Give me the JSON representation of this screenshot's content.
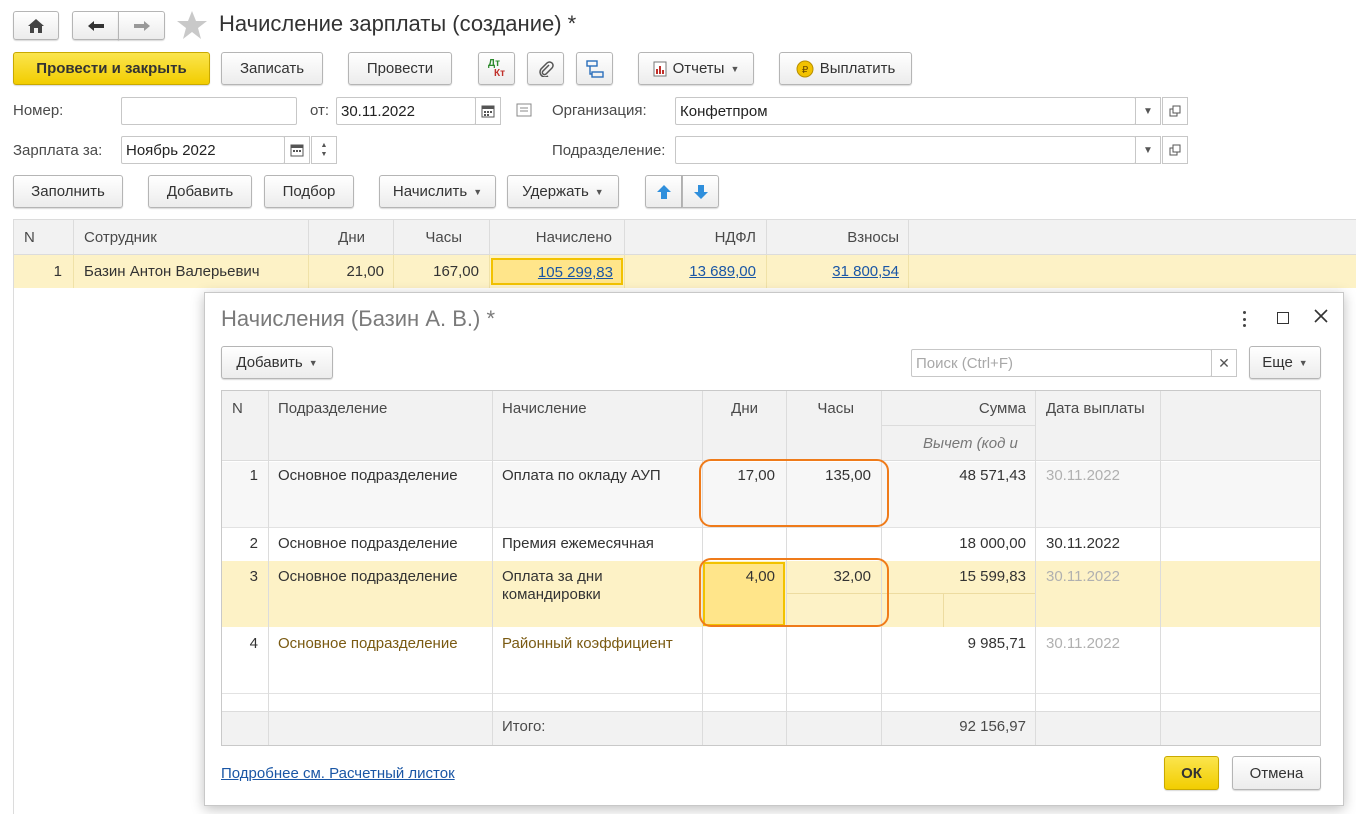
{
  "window": {
    "title": "Начисление зарплаты (создание) *"
  },
  "toolbar": {
    "post_close": "Провести и закрыть",
    "save": "Записать",
    "post": "Провести",
    "dt_icon_top": "Дт",
    "dt_icon_bottom": "Кт",
    "reports": "Отчеты",
    "pay": "Выплатить"
  },
  "form": {
    "number_label": "Номер:",
    "number_value": "",
    "date_label": "от:",
    "date_value": "30.11.2022",
    "org_label": "Организация:",
    "org_value": "Конфетпром",
    "salary_for_label": "Зарплата за:",
    "salary_for_value": "Ноябрь 2022",
    "dept_label": "Подразделение:",
    "dept_value": ""
  },
  "table_toolbar": {
    "fill": "Заполнить",
    "add": "Добавить",
    "pick": "Подбор",
    "accrue": "Начислить",
    "deduct": "Удержать"
  },
  "main_table": {
    "columns": [
      "N",
      "Сотрудник",
      "Дни",
      "Часы",
      "Начислено",
      "НДФЛ",
      "Взносы"
    ],
    "rows": [
      {
        "n": "1",
        "employee": "Базин Антон Валерьевич",
        "days": "21,00",
        "hours": "167,00",
        "accrued": "105 299,83",
        "ndfl": "13 689,00",
        "contrib": "31 800,54"
      }
    ]
  },
  "dialog": {
    "title": "Начисления (Базин А. В.) *",
    "add": "Добавить",
    "search_placeholder": "Поиск (Ctrl+F)",
    "more": "Еще",
    "columns": {
      "n": "N",
      "dept": "Подразделение",
      "accrual": "Начисление",
      "days": "Дни",
      "hours": "Часы",
      "sum": "Сумма",
      "sum_sub": "Вычет (код и",
      "pay_date": "Дата выплаты"
    },
    "rows": [
      {
        "n": "1",
        "dept": "Основное подразделение",
        "accrual": "Оплата по окладу АУП",
        "accrual2": "",
        "days": "17,00",
        "hours": "135,00",
        "sum": "48 571,43",
        "pay_date": "30.11.2022"
      },
      {
        "n": "2",
        "dept": "Основное подразделение",
        "accrual": "Премия ежемесячная",
        "accrual2": "",
        "days": "",
        "hours": "",
        "sum": "18 000,00",
        "pay_date": "30.11.2022"
      },
      {
        "n": "3",
        "dept": "Основное подразделение",
        "accrual": "Оплата за дни",
        "accrual2": "командировки",
        "days": "4,00",
        "hours": "32,00",
        "sum": "15 599,83",
        "pay_date": "30.11.2022"
      },
      {
        "n": "4",
        "dept": "Основное подразделение",
        "accrual": "Районный коэффициент",
        "accrual2": "",
        "days": "",
        "hours": "",
        "sum": "9 985,71",
        "pay_date": "30.11.2022"
      }
    ],
    "footer": {
      "total_label": "Итого:",
      "total_sum": "92 156,97"
    },
    "details_link": "Подробнее см. Расчетный листок",
    "ok": "ОК",
    "cancel": "Отмена"
  },
  "colors": {
    "accent_yellow": "#f5d800",
    "selected_row": "#fdf2c6",
    "highlight_outline": "#ef7b1a",
    "link": "#1a56a5"
  }
}
